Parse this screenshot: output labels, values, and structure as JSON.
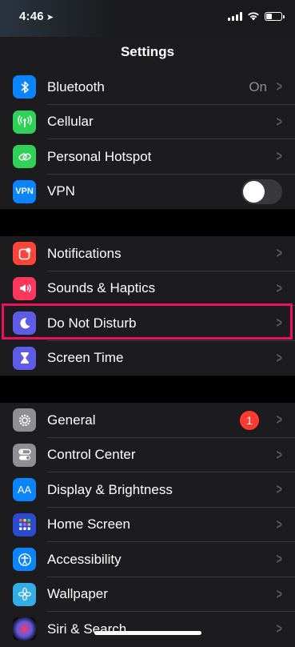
{
  "status": {
    "time": "4:46"
  },
  "nav": {
    "title": "Settings"
  },
  "groups": [
    {
      "items": [
        {
          "label": "Bluetooth",
          "value": "On",
          "icon": "bluetooth-icon",
          "color": "#0a84ff"
        },
        {
          "label": "Cellular",
          "icon": "cellular-antenna-icon",
          "color": "#30d158"
        },
        {
          "label": "Personal Hotspot",
          "icon": "hotspot-link-icon",
          "color": "#30d158"
        },
        {
          "label": "VPN",
          "icon": "vpn-icon",
          "icon_text": "VPN",
          "color": "#0a84ff",
          "toggle_on": false
        }
      ]
    },
    {
      "items": [
        {
          "label": "Notifications",
          "icon": "notifications-icon",
          "color": "#ff453a"
        },
        {
          "label": "Sounds & Haptics",
          "icon": "speaker-icon",
          "color": "#ff375f"
        },
        {
          "label": "Do Not Disturb",
          "icon": "moon-icon",
          "color": "#5e5ce6",
          "highlighted": true
        },
        {
          "label": "Screen Time",
          "icon": "hourglass-icon",
          "color": "#5e5ce6"
        }
      ]
    },
    {
      "items": [
        {
          "label": "General",
          "icon": "gear-icon",
          "color": "#8e8e93",
          "badge": "1"
        },
        {
          "label": "Control Center",
          "icon": "toggles-icon",
          "color": "#8e8e93"
        },
        {
          "label": "Display & Brightness",
          "icon": "text-size-icon",
          "icon_text": "AA",
          "color": "#0a84ff"
        },
        {
          "label": "Home Screen",
          "icon": "app-grid-icon",
          "color": "#2c4bd0"
        },
        {
          "label": "Accessibility",
          "icon": "accessibility-icon",
          "color": "#0a84ff"
        },
        {
          "label": "Wallpaper",
          "icon": "flower-icon",
          "color": "#32ade6"
        },
        {
          "label": "Siri & Search",
          "icon": "siri-icon",
          "color": "#1c1c1e"
        }
      ]
    }
  ],
  "colors": {
    "highlight_border": "#e8115b",
    "badge": "#ff3b30"
  }
}
